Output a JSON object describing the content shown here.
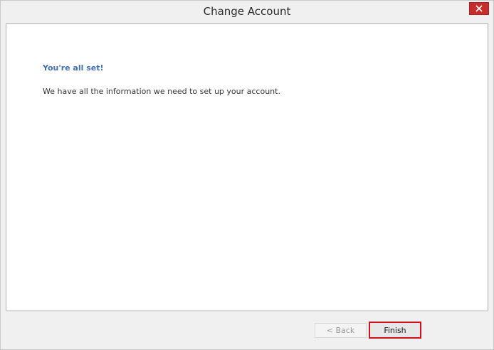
{
  "window": {
    "title": "Change Account"
  },
  "content": {
    "heading": "You're all set!",
    "message": "We have all the information we need to set up your account."
  },
  "buttons": {
    "back_label": "< Back",
    "finish_label": "Finish"
  },
  "colors": {
    "heading_blue": "#3f6fb5",
    "close_red": "#c72d2d",
    "highlight_red": "#d0101a",
    "window_bg": "#f0f0f0"
  },
  "icons": {
    "close": "close-icon"
  }
}
